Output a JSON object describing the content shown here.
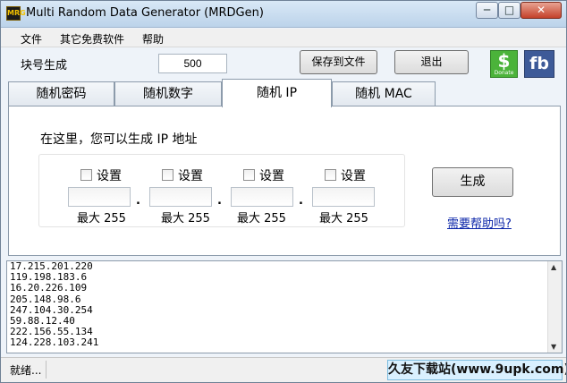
{
  "window": {
    "app_icon_text": "MRG",
    "title": "Multi Random Data Generator (MRDGen)",
    "min_glyph": "─",
    "max_glyph": "□",
    "close_glyph": "✕"
  },
  "menu": [
    "文件",
    "其它免费软件",
    "帮助"
  ],
  "toolbar": {
    "block_label": "块号生成",
    "block_value": "500",
    "save_label": "保存到文件",
    "exit_label": "退出",
    "donate_glyph": "$",
    "donate_label": "Donate",
    "fb_label": "fb"
  },
  "tabs": [
    {
      "label": "随机密码",
      "active": false
    },
    {
      "label": "随机数字",
      "active": false
    },
    {
      "label": "随机 IP",
      "active": true
    },
    {
      "label": "随机 MAC",
      "active": false
    }
  ],
  "panel": {
    "heading": "在这里，您可以生成 IP 地址",
    "octets": [
      {
        "checkbox_label": "设置",
        "value": "",
        "max_label": "最大 255"
      },
      {
        "checkbox_label": "设置",
        "value": "",
        "max_label": "最大 255"
      },
      {
        "checkbox_label": "设置",
        "value": "",
        "max_label": "最大 255"
      },
      {
        "checkbox_label": "设置",
        "value": "",
        "max_label": "最大 255"
      }
    ],
    "separator": ".",
    "generate_label": "生成",
    "help_link": "需要帮助吗?"
  },
  "output_lines": [
    "17.215.201.220",
    "119.198.183.6",
    "16.20.226.109",
    "205.148.98.6",
    "247.104.30.254",
    "59.88.12.40",
    "222.156.55.134",
    "124.228.103.241"
  ],
  "scrollbar": {
    "up_glyph": "▲",
    "down_glyph": "▼"
  },
  "status": {
    "text": "就绪..."
  },
  "watermark": "久友下载站(www.9upk.com)",
  "colors": {
    "donate": "#4bb33a",
    "facebook": "#3d5a98",
    "link": "#0a24a8",
    "close": "#c4412b"
  }
}
